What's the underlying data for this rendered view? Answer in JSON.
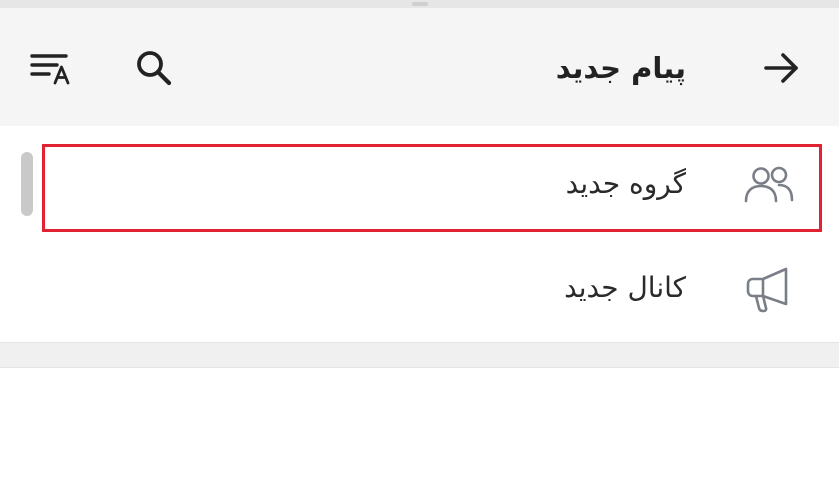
{
  "header": {
    "title": "پیام جدید",
    "back_icon": "arrow-right-icon",
    "search_icon": "search-icon",
    "sort_icon": "sort-by-name-icon"
  },
  "menu": {
    "items": [
      {
        "label": "گروه جدید",
        "icon": "people-icon",
        "highlighted": true
      },
      {
        "label": "کانال جدید",
        "icon": "megaphone-icon",
        "highlighted": false
      }
    ]
  },
  "colors": {
    "header_bg": "#f5f5f5",
    "highlight": "#e02233",
    "icon_color": "#222222",
    "list_icon_color": "#7a7f87"
  }
}
